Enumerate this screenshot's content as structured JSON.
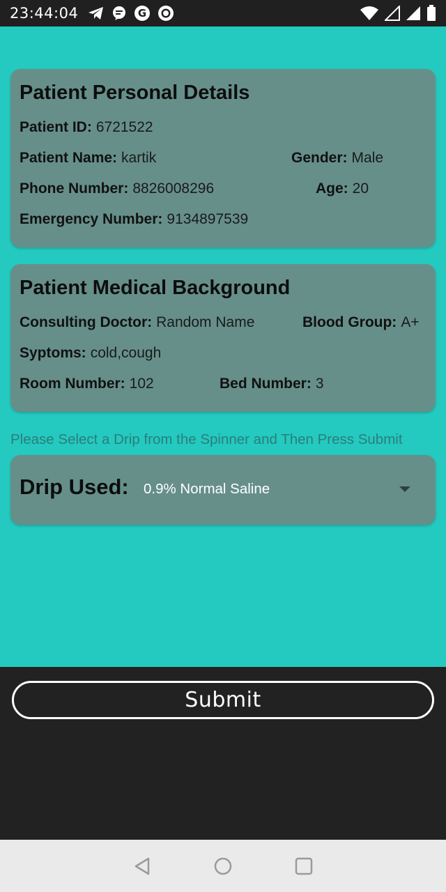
{
  "status_bar": {
    "time": "23:44:04",
    "left_icons": [
      "telegram-icon",
      "chat-icon",
      "google-icon",
      "record-icon"
    ],
    "right_icons": [
      "wifi-icon",
      "signal-empty-icon",
      "signal-full-icon",
      "battery-icon"
    ]
  },
  "personal": {
    "title": "Patient Personal Details",
    "patient_id_label": "Patient ID:",
    "patient_id": "6721522",
    "name_label": "Patient Name:",
    "name": "kartik",
    "gender_label": "Gender:",
    "gender": "Male",
    "phone_label": "Phone Number:",
    "phone": "8826008296",
    "age_label": "Age:",
    "age": "20",
    "emergency_label": "Emergency Number:",
    "emergency": "9134897539"
  },
  "medical": {
    "title": "Patient Medical Background",
    "doctor_label": "Consulting Doctor:",
    "doctor": "Random Name",
    "blood_label": "Blood Group:",
    "blood": "A+",
    "symptoms_label": "Syptoms:",
    "symptoms": "cold,cough",
    "room_label": "Room Number:",
    "room": "102",
    "bed_label": "Bed Number:",
    "bed": "3"
  },
  "hint": "Please Select a Drip from the Spinner and Then Press Submit",
  "drip": {
    "label": "Drip Used:",
    "selected": "0.9% Normal Saline"
  },
  "submit_label": "Submit",
  "colors": {
    "background": "#24c9bf",
    "card": "#668f8a",
    "hint_text": "#2a7f7a",
    "dark": "#222222",
    "nav_bar": "#eaeaea"
  },
  "nav": [
    "back-icon",
    "home-icon",
    "recents-icon"
  ]
}
